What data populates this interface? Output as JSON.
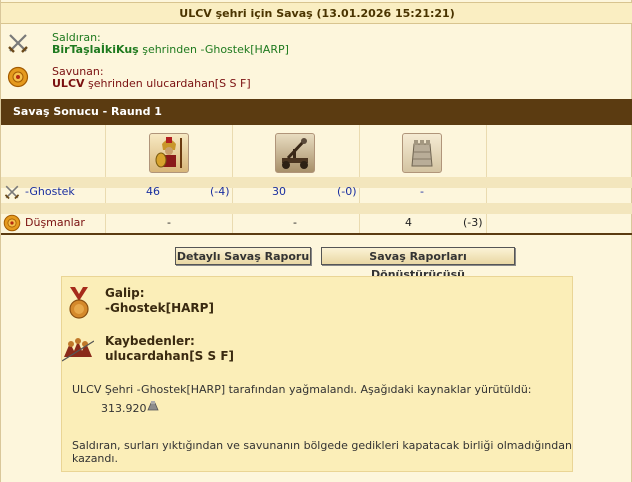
{
  "window_title": "ULCV şehri için Savaş (13.01.2026 15:21:21)",
  "attacker": {
    "label": "Saldıran:",
    "player": "BirTaşlaİkiKuş",
    "city_text": " şehrinden -Ghostek[HARP]"
  },
  "defender": {
    "label": "Savunan:",
    "city": "ULCV",
    "city_text": " şehrinden ulucardahan[S S F]"
  },
  "section_title": "Savaş Sonucu - Raund 1",
  "units": [
    {
      "icon": "hoplite-icon"
    },
    {
      "icon": "catapult-icon"
    },
    {
      "icon": "wall-icon"
    }
  ],
  "rows": [
    {
      "name": "-Ghostek",
      "icon": "crossed-swords-icon",
      "cells": [
        {
          "value": "46",
          "loss": "(-4)"
        },
        {
          "value": "30",
          "loss": "(-0)"
        },
        {
          "value": "-",
          "loss": ""
        }
      ]
    },
    {
      "name": "Düşmanlar",
      "icon": "shield-icon",
      "cells": [
        {
          "value": "-",
          "loss": ""
        },
        {
          "value": "-",
          "loss": ""
        },
        {
          "value": "4",
          "loss": "(-3)"
        }
      ]
    }
  ],
  "buttons": {
    "detailed_report": "Detaylı Savaş Raporu",
    "report_converter": "Savaş Raporları Dönüştürücüsü"
  },
  "result": {
    "winner_label": "Galip:",
    "winner_name": "-Ghostek[HARP]",
    "losers_label": "Kaybedenler:",
    "losers_name": "ulucardahan[S S F]",
    "plunder_text": "ULCV Şehri -Ghostek[HARP] tarafından yağmalandı. Aşağıdaki kaynaklar yürütüldü:",
    "plunder_amount": "313.920",
    "footer_text_1": "Saldıran, surları yıktığından ve savunanın bölgede gedikleri kapatacak birliği olmadığından",
    "footer_text_2": "kazandı."
  }
}
